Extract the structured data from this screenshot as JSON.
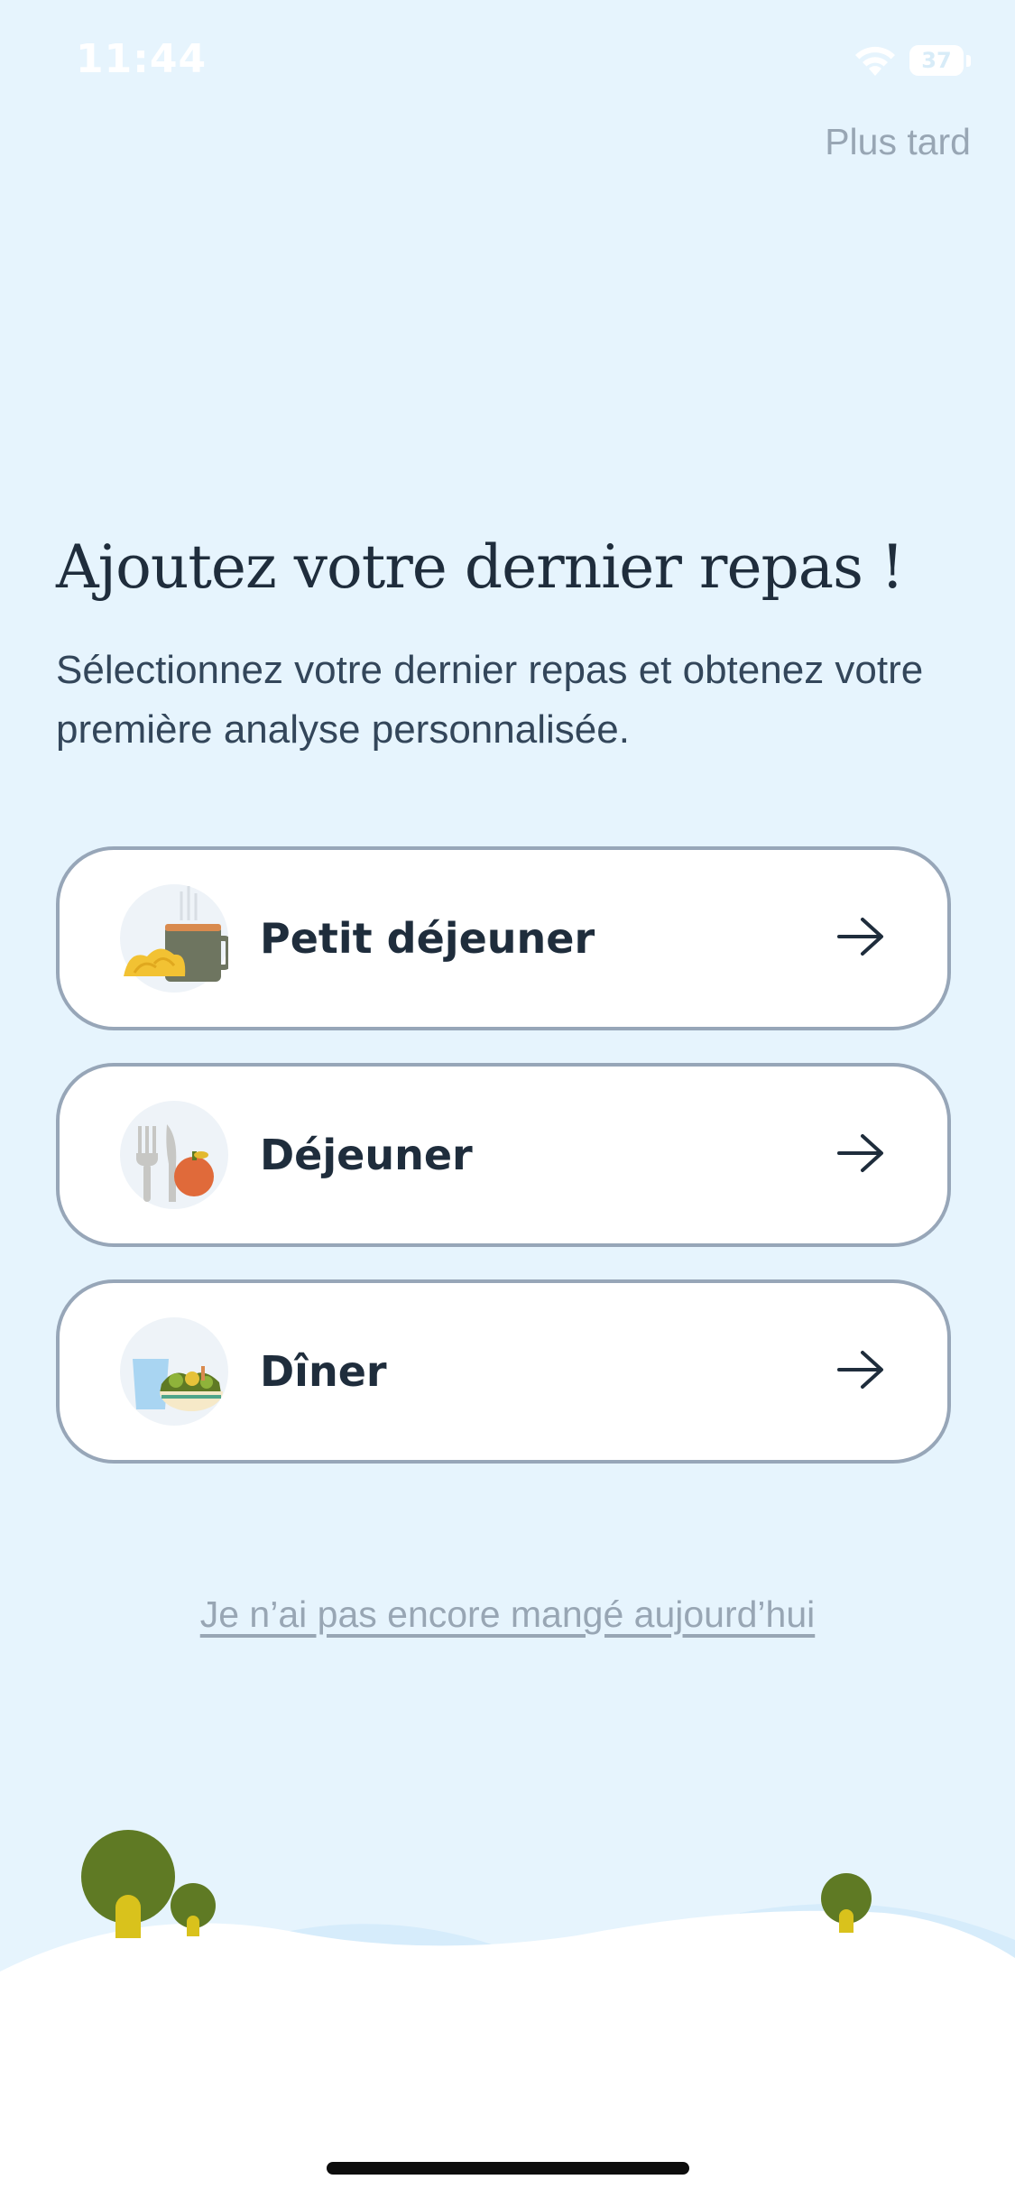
{
  "status_bar": {
    "time": "11:44",
    "battery_level": "37",
    "wifi_icon": "wifi-icon",
    "battery_icon": "battery-icon"
  },
  "header": {
    "later_label": "Plus tard"
  },
  "main": {
    "title": "Ajoutez votre dernier repas !",
    "subtitle": "Sélectionnez votre dernier repas et obtenez votre première analyse personnalisée."
  },
  "meals": [
    {
      "label": "Petit déjeuner",
      "icon": "breakfast-icon"
    },
    {
      "label": "Déjeuner",
      "icon": "lunch-icon"
    },
    {
      "label": "Dîner",
      "icon": "dinner-icon"
    }
  ],
  "footer": {
    "not_eaten_label": "Je n’ai pas encore mangé aujourd’hui"
  },
  "colors": {
    "background": "#e6f4fd",
    "card_border": "#97a6b8",
    "text_primary": "#1f2d3c",
    "link_muted": "#98a6b4"
  }
}
